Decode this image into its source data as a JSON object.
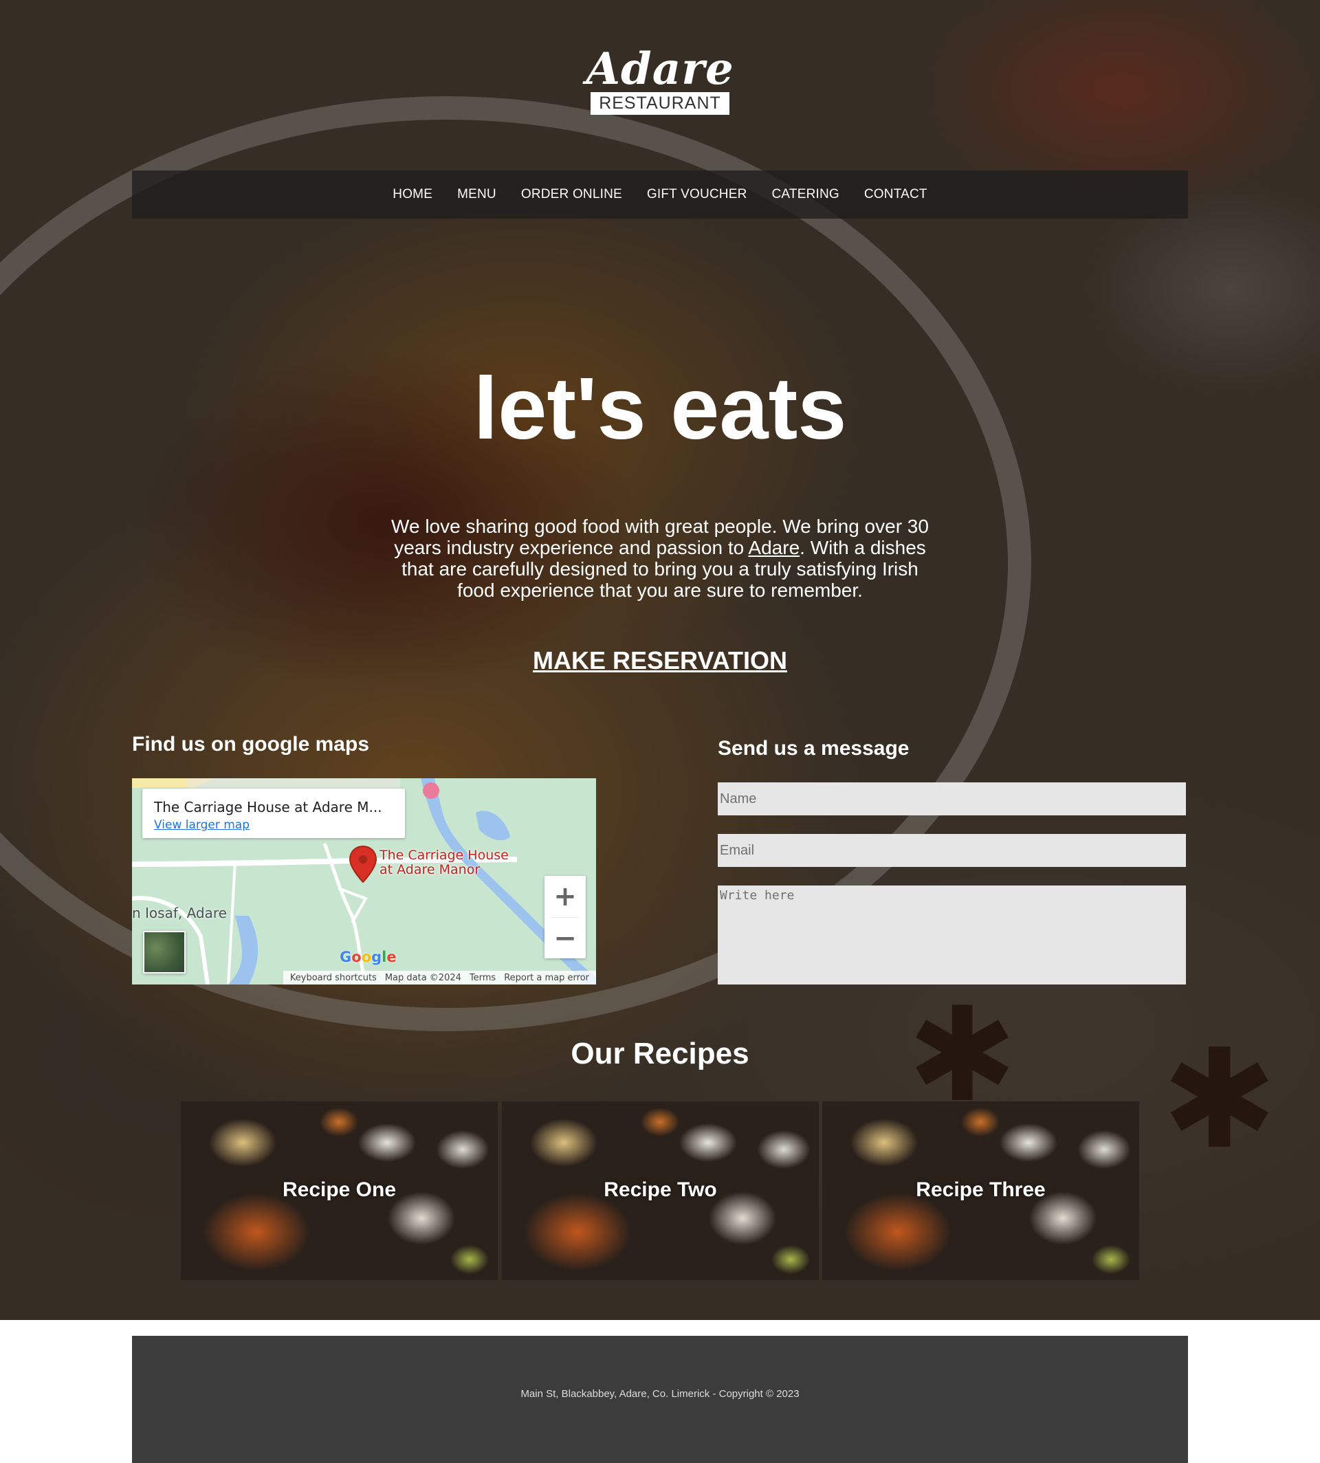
{
  "brand": {
    "name": "Adare",
    "subtitle": "RESTAURANT"
  },
  "nav": {
    "items": [
      "HOME",
      "MENU",
      "ORDER ONLINE",
      "GIFT VOUCHER",
      "CATERING",
      "CONTACT"
    ]
  },
  "hero": {
    "headline": "let's eats",
    "intro_before": "We love sharing good food with great people. We bring over 30 years industry experience and passion to ",
    "intro_link": "Adare",
    "intro_after": ". With a dishes that are carefully designed to bring you a truly satisfying Irish food experience that you are sure to remember.",
    "cta": "MAKE RESERVATION"
  },
  "map": {
    "title": "Find us on google maps",
    "place_name": "The Carriage House at Adare M...",
    "larger_map_link": "View larger map",
    "pin_label_line1": "The Carriage House",
    "pin_label_line2": "at Adare Manor",
    "area_label": "n Iosaf, Adare",
    "zoom_in": "+",
    "zoom_out": "−",
    "logo": "Google",
    "footer_links": [
      "Keyboard shortcuts",
      "Map data ©2024",
      "Terms",
      "Report a map error"
    ]
  },
  "contact_form": {
    "title": "Send us a message",
    "name_placeholder": "Name",
    "email_placeholder": "Email",
    "message_placeholder": "Write here"
  },
  "recipes": {
    "title": "Our Recipes",
    "items": [
      "Recipe One",
      "Recipe Two",
      "Recipe Three"
    ]
  },
  "footer": {
    "text": "Main St, Blackabbey, Adare, Co. Limerick - Copyright © 2023"
  },
  "colors": {
    "nav_background": "#1e1e1e",
    "form_field_background": "#e6e6e6",
    "footer_background": "#3c3c3c",
    "map_link": "#1a73e8",
    "map_pin": "#d93025"
  }
}
